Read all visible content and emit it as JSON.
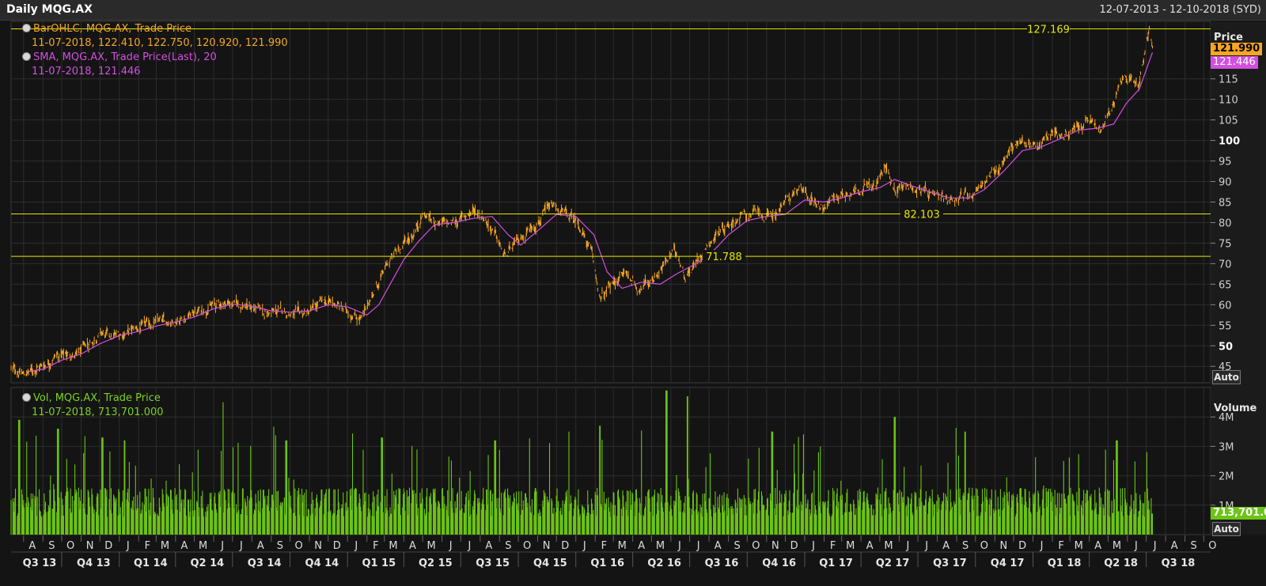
{
  "header": {
    "title": "Daily MQG.AX",
    "date_range": "12-07-2013 - 12-10-2018 (SYD)"
  },
  "colors": {
    "price_bars": "#f5a623",
    "sma": "#d34fe0",
    "volume": "#6cc414",
    "level_lines": "#e6e600",
    "background": "#141414",
    "grid": "#2e2e2e"
  },
  "legend": {
    "ohlc_name": "BarOHLC, MQG.AX, Trade Price",
    "ohlc_values": "11-07-2018, 122.410, 122.750, 120.920, 121.990",
    "sma_name": "SMA, MQG.AX, Trade Price(Last),  20",
    "sma_values": "11-07-2018, 121.446",
    "vol_name": "Vol, MQG.AX, Trade Price",
    "vol_values": "11-07-2018, 713,701.000"
  },
  "price_axis": {
    "title": "Price",
    "last_price": "121.990",
    "sma_last": "121.446",
    "auto_label": "Auto"
  },
  "volume_axis": {
    "title": "Volume",
    "last_volume": "713,701.0",
    "auto_label": "Auto"
  },
  "chart_data": [
    {
      "type": "line",
      "title": "Daily MQG.AX",
      "ylabel": "Price",
      "ylim": [
        41,
        129
      ],
      "yticks": [
        45,
        50,
        55,
        60,
        65,
        70,
        75,
        80,
        85,
        90,
        95,
        100,
        105,
        110,
        115
      ],
      "ytick_bold": [
        50,
        100
      ],
      "xlim": [
        "2013-07-12",
        "2018-10-12"
      ],
      "series": [
        {
          "name": "BarOHLC, MQG.AX, Trade Price",
          "points": [
            [
              "2013-07-12",
              44.5
            ],
            [
              "2013-08-01",
              43.0
            ],
            [
              "2013-08-20",
              44.5
            ],
            [
              "2013-09-05",
              45.5
            ],
            [
              "2013-09-20",
              47.5
            ],
            [
              "2013-10-10",
              48.0
            ],
            [
              "2013-10-25",
              47.5
            ],
            [
              "2013-11-10",
              50.0
            ],
            [
              "2013-12-01",
              53.0
            ],
            [
              "2013-12-20",
              52.0
            ],
            [
              "2014-01-15",
              53.5
            ],
            [
              "2014-02-05",
              54.5
            ],
            [
              "2014-02-25",
              55.5
            ],
            [
              "2014-03-20",
              56.0
            ],
            [
              "2014-04-10",
              56.5
            ],
            [
              "2014-05-01",
              58.0
            ],
            [
              "2014-05-25",
              59.5
            ],
            [
              "2014-06-20",
              60.5
            ],
            [
              "2014-07-15",
              60.0
            ],
            [
              "2014-08-05",
              59.0
            ],
            [
              "2014-08-25",
              58.0
            ],
            [
              "2014-09-20",
              58.5
            ],
            [
              "2014-10-10",
              57.5
            ],
            [
              "2014-10-30",
              58.0
            ],
            [
              "2014-11-20",
              60.5
            ],
            [
              "2014-12-10",
              60.5
            ],
            [
              "2015-01-05",
              58.0
            ],
            [
              "2015-01-25",
              56.5
            ],
            [
              "2015-02-05",
              61.0
            ],
            [
              "2015-02-20",
              65.5
            ],
            [
              "2015-03-10",
              71.0
            ],
            [
              "2015-03-25",
              74.0
            ],
            [
              "2015-04-15",
              77.0
            ],
            [
              "2015-05-01",
              82.0
            ],
            [
              "2015-05-20",
              80.5
            ],
            [
              "2015-06-10",
              79.5
            ],
            [
              "2015-07-01",
              81.0
            ],
            [
              "2015-07-20",
              83.0
            ],
            [
              "2015-08-05",
              82.0
            ],
            [
              "2015-08-25",
              77.0
            ],
            [
              "2015-09-10",
              71.5
            ],
            [
              "2015-09-25",
              74.5
            ],
            [
              "2015-10-15",
              78.0
            ],
            [
              "2015-11-05",
              81.0
            ],
            [
              "2015-11-25",
              84.0
            ],
            [
              "2015-12-15",
              82.0
            ],
            [
              "2016-01-05",
              80.0
            ],
            [
              "2016-01-25",
              73.0
            ],
            [
              "2016-02-10",
              61.0
            ],
            [
              "2016-02-25",
              64.5
            ],
            [
              "2016-03-20",
              68.0
            ],
            [
              "2016-04-10",
              64.0
            ],
            [
              "2016-05-01",
              66.0
            ],
            [
              "2016-05-20",
              69.5
            ],
            [
              "2016-06-10",
              73.5
            ],
            [
              "2016-06-24",
              67.0
            ],
            [
              "2016-07-10",
              70.0
            ],
            [
              "2016-07-31",
              75.0
            ],
            [
              "2016-08-25",
              79.0
            ],
            [
              "2016-09-20",
              81.5
            ],
            [
              "2016-10-15",
              82.5
            ],
            [
              "2016-11-05",
              81.0
            ],
            [
              "2016-11-25",
              84.0
            ],
            [
              "2016-12-20",
              88.0
            ],
            [
              "2017-01-10",
              86.0
            ],
            [
              "2017-01-30",
              84.0
            ],
            [
              "2017-02-20",
              86.5
            ],
            [
              "2017-03-15",
              87.5
            ],
            [
              "2017-04-05",
              88.5
            ],
            [
              "2017-04-25",
              89.0
            ],
            [
              "2017-05-10",
              93.5
            ],
            [
              "2017-05-25",
              88.5
            ],
            [
              "2017-06-15",
              89.0
            ],
            [
              "2017-07-05",
              88.0
            ],
            [
              "2017-07-25",
              86.0
            ],
            [
              "2017-08-15",
              85.5
            ],
            [
              "2017-09-05",
              86.5
            ],
            [
              "2017-09-25",
              87.0
            ],
            [
              "2017-10-15",
              90.0
            ],
            [
              "2017-11-05",
              92.5
            ],
            [
              "2017-11-25",
              98.0
            ],
            [
              "2017-12-15",
              99.5
            ],
            [
              "2018-01-10",
              99.0
            ],
            [
              "2018-02-01",
              102.5
            ],
            [
              "2018-02-20",
              101.0
            ],
            [
              "2018-03-15",
              103.0
            ],
            [
              "2018-04-01",
              105.0
            ],
            [
              "2018-04-20",
              102.0
            ],
            [
              "2018-05-05",
              107.0
            ],
            [
              "2018-05-20",
              114.0
            ],
            [
              "2018-06-05",
              115.5
            ],
            [
              "2018-06-20",
              114.0
            ],
            [
              "2018-07-01",
              124.0
            ],
            [
              "2018-07-06",
              127.0
            ],
            [
              "2018-07-11",
              121.99
            ]
          ]
        },
        {
          "name": "SMA, MQG.AX, Trade Price(Last),  20",
          "points": [
            [
              "2013-08-10",
              43.8
            ],
            [
              "2013-09-01",
              44.3
            ],
            [
              "2013-10-01",
              46.5
            ],
            [
              "2013-11-01",
              48.0
            ],
            [
              "2013-12-01",
              50.5
            ],
            [
              "2014-01-01",
              52.5
            ],
            [
              "2014-02-01",
              53.5
            ],
            [
              "2014-03-01",
              54.8
            ],
            [
              "2014-04-01",
              55.8
            ],
            [
              "2014-05-01",
              57.0
            ],
            [
              "2014-06-01",
              59.0
            ],
            [
              "2014-07-01",
              60.2
            ],
            [
              "2014-08-01",
              59.6
            ],
            [
              "2014-09-01",
              58.5
            ],
            [
              "2014-10-01",
              58.2
            ],
            [
              "2014-11-01",
              58.5
            ],
            [
              "2014-12-01",
              60.0
            ],
            [
              "2015-01-01",
              59.5
            ],
            [
              "2015-02-01",
              57.5
            ],
            [
              "2015-02-20",
              60.0
            ],
            [
              "2015-03-10",
              65.0
            ],
            [
              "2015-04-01",
              71.0
            ],
            [
              "2015-04-25",
              75.5
            ],
            [
              "2015-05-20",
              79.5
            ],
            [
              "2015-06-20",
              80.0
            ],
            [
              "2015-07-20",
              81.0
            ],
            [
              "2015-08-20",
              81.5
            ],
            [
              "2015-09-15",
              77.0
            ],
            [
              "2015-10-05",
              74.5
            ],
            [
              "2015-11-01",
              78.0
            ],
            [
              "2015-12-01",
              82.0
            ],
            [
              "2016-01-01",
              81.5
            ],
            [
              "2016-01-30",
              77.0
            ],
            [
              "2016-02-20",
              68.0
            ],
            [
              "2016-03-15",
              64.0
            ],
            [
              "2016-04-15",
              65.5
            ],
            [
              "2016-05-15",
              65.0
            ],
            [
              "2016-06-10",
              67.5
            ],
            [
              "2016-07-05",
              69.5
            ],
            [
              "2016-08-01",
              72.0
            ],
            [
              "2016-09-01",
              77.0
            ],
            [
              "2016-10-01",
              80.5
            ],
            [
              "2016-11-01",
              81.5
            ],
            [
              "2016-12-01",
              82.0
            ],
            [
              "2017-01-01",
              85.5
            ],
            [
              "2017-02-01",
              85.0
            ],
            [
              "2017-03-01",
              86.0
            ],
            [
              "2017-04-01",
              87.5
            ],
            [
              "2017-05-01",
              88.5
            ],
            [
              "2017-05-25",
              90.5
            ],
            [
              "2017-06-20",
              89.0
            ],
            [
              "2017-07-20",
              87.5
            ],
            [
              "2017-08-20",
              86.0
            ],
            [
              "2017-09-20",
              86.0
            ],
            [
              "2017-10-15",
              88.0
            ],
            [
              "2017-11-15",
              92.5
            ],
            [
              "2017-12-15",
              97.5
            ],
            [
              "2018-01-15",
              98.5
            ],
            [
              "2018-02-15",
              100.5
            ],
            [
              "2018-03-15",
              102.5
            ],
            [
              "2018-04-15",
              103.0
            ],
            [
              "2018-05-10",
              104.0
            ],
            [
              "2018-05-30",
              109.0
            ],
            [
              "2018-06-20",
              112.5
            ],
            [
              "2018-07-11",
              121.446
            ]
          ]
        }
      ],
      "annotations": [
        {
          "label": "127.169",
          "value": 127.169
        },
        {
          "label": "82.103",
          "value": 82.103
        },
        {
          "label": "71.788",
          "value": 71.788
        }
      ]
    },
    {
      "type": "bar",
      "ylabel": "Volume",
      "ylim": [
        0,
        5000000
      ],
      "yticks": [
        "1M",
        "2M",
        "3M",
        "4M"
      ],
      "typical_range": [
        600000,
        1600000
      ],
      "spikes": [
        [
          "2013-07-25",
          3900000
        ],
        [
          "2013-09-25",
          3600000
        ],
        [
          "2013-12-05",
          3300000
        ],
        [
          "2014-01-10",
          3200000
        ],
        [
          "2014-06-15",
          4500000
        ],
        [
          "2014-09-25",
          3200000
        ],
        [
          "2015-02-25",
          3300000
        ],
        [
          "2015-08-25",
          3200000
        ],
        [
          "2015-12-20",
          3500000
        ],
        [
          "2016-02-08",
          3700000
        ],
        [
          "2016-05-25",
          4900000
        ],
        [
          "2016-06-27",
          4700000
        ],
        [
          "2016-11-10",
          3500000
        ],
        [
          "2017-05-25",
          4000000
        ],
        [
          "2017-09-15",
          3500000
        ],
        [
          "2018-05-15",
          3200000
        ],
        [
          "2018-07-01",
          2800000
        ],
        [
          "2018-07-11",
          713701
        ]
      ]
    }
  ],
  "x_axis": {
    "months": [
      "A",
      "S",
      "O",
      "N",
      "D",
      "J",
      "F",
      "M",
      "A",
      "M",
      "J",
      "J",
      "A",
      "S",
      "O",
      "N",
      "D",
      "J",
      "F",
      "M",
      "A",
      "M",
      "J",
      "J",
      "A",
      "S",
      "O",
      "N",
      "D",
      "J",
      "F",
      "M",
      "A",
      "M",
      "J",
      "J",
      "A",
      "S",
      "O",
      "N",
      "D",
      "J",
      "F",
      "M",
      "A",
      "M",
      "J",
      "J",
      "A",
      "S",
      "O",
      "N",
      "D",
      "J",
      "F",
      "M",
      "A",
      "M",
      "J",
      "J",
      "A",
      "S",
      "O"
    ],
    "quarters": [
      "Q3 13",
      "Q4 13",
      "Q1 14",
      "Q2 14",
      "Q3 14",
      "Q4 14",
      "Q1 15",
      "Q2 15",
      "Q3 15",
      "Q4 15",
      "Q1 16",
      "Q2 16",
      "Q3 16",
      "Q4 16",
      "Q1 17",
      "Q2 17",
      "Q3 17",
      "Q4 17",
      "Q1 18",
      "Q2 18",
      "Q3 18"
    ]
  }
}
